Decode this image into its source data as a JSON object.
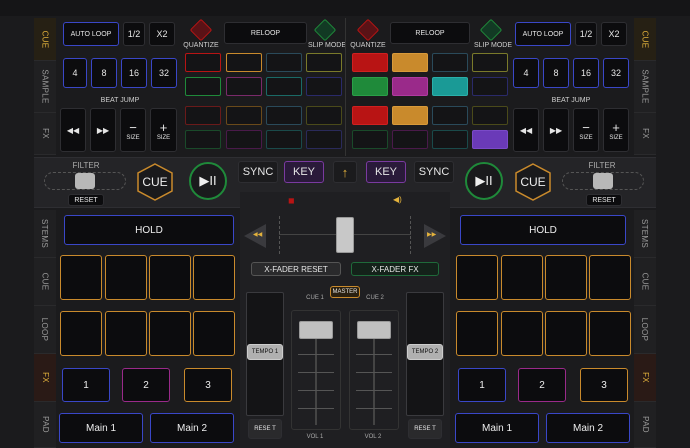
{
  "tabs_left_top": [
    {
      "label": "CUE",
      "active": true
    },
    {
      "label": "SAMPLE",
      "active": false
    },
    {
      "label": "FX",
      "active": false
    }
  ],
  "tabs_right_top": [
    {
      "label": "CUE",
      "active": true
    },
    {
      "label": "SAMPLE",
      "active": false
    },
    {
      "label": "FX",
      "active": false
    }
  ],
  "tabs_left_bottom": [
    {
      "label": "STEMS",
      "active": false
    },
    {
      "label": "CUE",
      "active": false
    },
    {
      "label": "LOOP",
      "active": false
    },
    {
      "label": "FX",
      "active": true
    },
    {
      "label": "PAD",
      "active": false
    }
  ],
  "tabs_right_bottom": [
    {
      "label": "STEMS",
      "active": false
    },
    {
      "label": "CUE",
      "active": false
    },
    {
      "label": "LOOP",
      "active": false
    },
    {
      "label": "FX",
      "active": true
    },
    {
      "label": "PAD",
      "active": false
    }
  ],
  "loop": {
    "autoloop": "AUTO LOOP",
    "half": "1/2",
    "double": "X2",
    "sizes": [
      "4",
      "8",
      "16",
      "32"
    ],
    "beat_jump": "BEAT JUMP",
    "back": "◀◀",
    "fwd": "▶▶",
    "minus": "−",
    "plus": "+",
    "size": "SIZE"
  },
  "center_top": {
    "quantize": "QUANTIZE",
    "reloop": "RELOOP",
    "slip": "SLIP MODE"
  },
  "deck": {
    "filter": "FILTER",
    "reset": "RESET",
    "cue": "CUE",
    "play": "▶II",
    "sync": "SYNC",
    "key": "KEY",
    "hold": "HOLD",
    "pads3": [
      "1",
      "2",
      "3"
    ],
    "main": [
      "Main 1",
      "Main 2"
    ]
  },
  "mixer": {
    "xfader_reset": "X-FADER RESET",
    "xfader_fx": "X-FADER FX",
    "master": "MASTER",
    "cue1": "CUE 1",
    "cue2": "CUE 2",
    "tempo1": "TEMPO 1",
    "tempo2": "TEMPO 2",
    "reset": "RESE T",
    "vol1": "VOL 1",
    "vol2": "VOL 2",
    "left_arrow": "◀◀",
    "right_arrow": "▶▶",
    "speaker": "🔈",
    "mute": "◼"
  },
  "colors": {
    "accent": "#e3b23c",
    "blue": "#3a47c8",
    "green": "#1f8a3a",
    "red": "#b81414",
    "orange": "#c98a2c",
    "purple": "#7a3aa0",
    "teal": "#1a9a96"
  }
}
